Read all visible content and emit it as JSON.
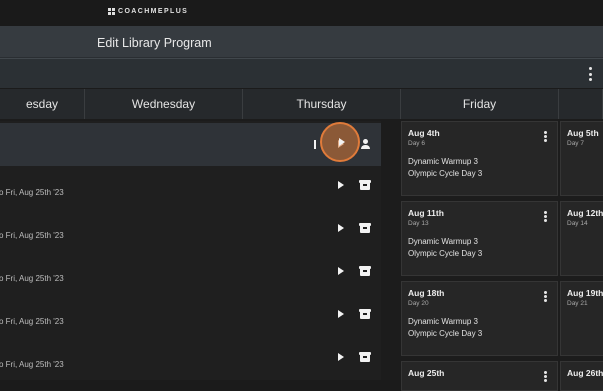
{
  "app": {
    "logo_text": "COACHMEPLUS"
  },
  "titlebar": {
    "title": "Edit Library Program"
  },
  "days": {
    "tuesday": "esday",
    "wednesday": "Wednesday",
    "thursday": "Thursday",
    "friday": "Friday"
  },
  "panel_rows": [
    {
      "subtitle": ""
    },
    {
      "subtitle": "o Fri, Aug 25th '23"
    },
    {
      "subtitle": "o Fri, Aug 25th '23"
    },
    {
      "subtitle": "o Fri, Aug 25th '23"
    },
    {
      "subtitle": "o Fri, Aug 25th '23"
    },
    {
      "subtitle": "o Fri, Aug 25th '23"
    }
  ],
  "friday_cells": [
    {
      "date": "Aug 4th",
      "day": "Day 6",
      "workouts": [
        "Dynamic Warmup 3",
        "Olympic Cycle Day 3"
      ]
    },
    {
      "date": "Aug 11th",
      "day": "Day 13",
      "workouts": [
        "Dynamic Warmup 3",
        "Olympic Cycle Day 3"
      ]
    },
    {
      "date": "Aug 18th",
      "day": "Day 20",
      "workouts": [
        "Dynamic Warmup 3",
        "Olympic Cycle Day 3"
      ]
    },
    {
      "date": "Aug 25th",
      "day": "",
      "workouts": [
        "",
        ""
      ]
    }
  ],
  "saturday_cells": [
    {
      "date": "Aug 5th",
      "day": "Day 7"
    },
    {
      "date": "Aug 12th",
      "day": "Day 14"
    },
    {
      "date": "Aug 19th",
      "day": "Day 21"
    },
    {
      "date": "Aug 26th",
      "day": ""
    }
  ],
  "colors": {
    "cursor_highlight": "#e07b3a",
    "panel_selected": "#2f3338"
  }
}
